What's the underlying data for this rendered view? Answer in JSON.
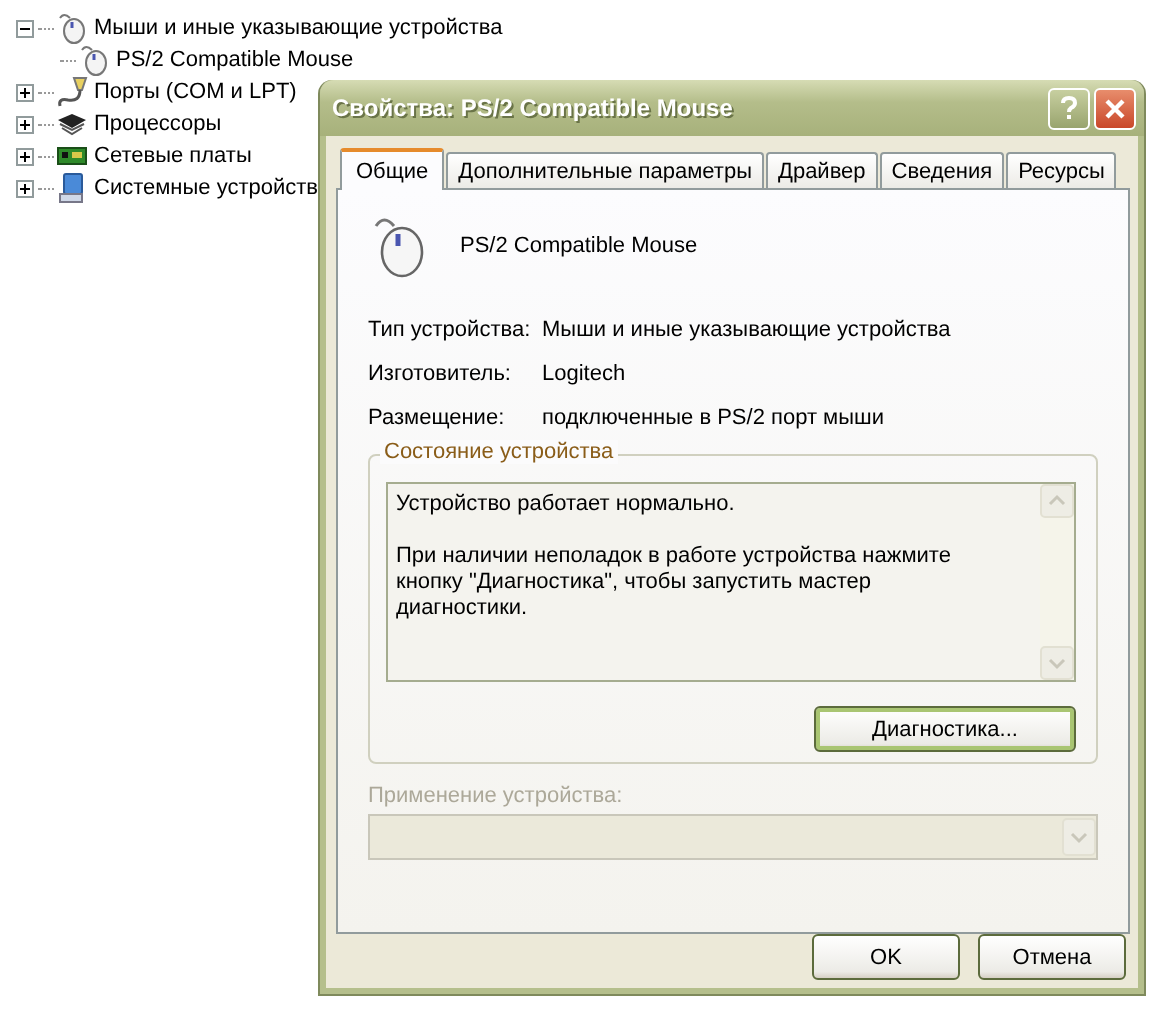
{
  "tree": [
    {
      "label": "Мыши и иные указывающие устройства",
      "kind": "mouse",
      "expanded": true,
      "children": [
        {
          "label": "PS/2 Compatible Mouse",
          "kind": "mouse"
        }
      ]
    },
    {
      "label": "Порты (COM и LPT)",
      "kind": "port",
      "expanded": false
    },
    {
      "label": "Процессоры",
      "kind": "cpu",
      "expanded": false
    },
    {
      "label": "Сетевые платы",
      "kind": "network",
      "expanded": false
    },
    {
      "label": "Системные устройств",
      "kind": "computer",
      "expanded": false
    }
  ],
  "dialog": {
    "title": "Свойства: PS/2 Compatible Mouse",
    "tabs": [
      {
        "label": "Общие",
        "selected": true
      },
      {
        "label": "Дополнительные параметры",
        "selected": false
      },
      {
        "label": "Драйвер",
        "selected": false
      },
      {
        "label": "Сведения",
        "selected": false
      },
      {
        "label": "Ресурсы",
        "selected": false
      }
    ],
    "device_name": "PS/2 Compatible Mouse",
    "properties": [
      {
        "label": "Тип устройства:",
        "value": "Мыши и иные указывающие устройства"
      },
      {
        "label": "Изготовитель:",
        "value": "Logitech"
      },
      {
        "label": "Размещение:",
        "value": "подключенные в PS/2 порт мыши"
      }
    ],
    "status_group": {
      "title": "Состояние устройства",
      "paragraphs": [
        "Устройство работает нормально.",
        "При наличии неполадок в работе устройства нажмите кнопку \"Диагностика\", чтобы запустить мастер диагностики."
      ],
      "button": {
        "label": "Диагностика...",
        "default": true
      }
    },
    "usage": {
      "label": "Применение устройства:",
      "disabled": true
    },
    "buttons": [
      {
        "label": "OK"
      },
      {
        "label": "Отмена"
      }
    ]
  }
}
